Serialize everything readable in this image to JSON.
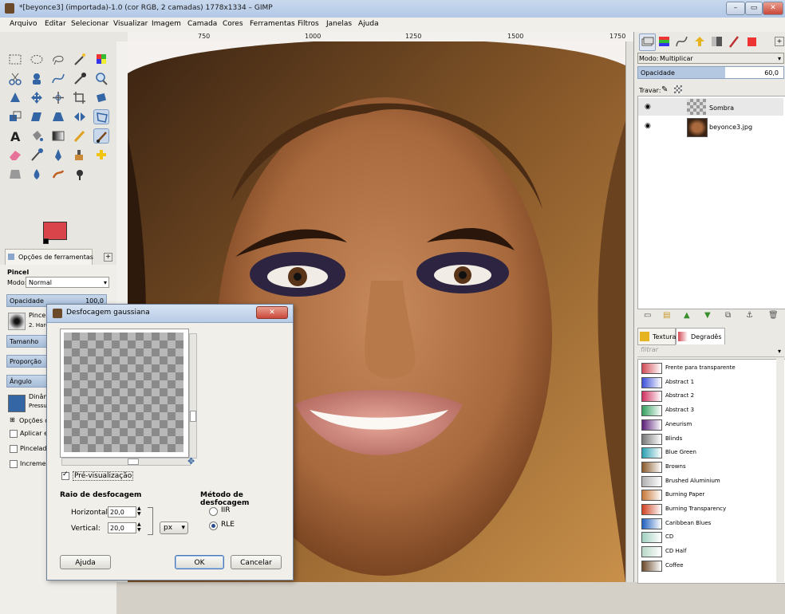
{
  "window": {
    "title": "*[beyonce3] (importada)-1.0 (cor RGB, 2 camadas) 1778x1334 – GIMP"
  },
  "menu": [
    "Arquivo",
    "Editar",
    "Selecionar",
    "Visualizar",
    "Imagem",
    "Camada",
    "Cores",
    "Ferramentas",
    "Filtros",
    "Janelas",
    "Ajuda"
  ],
  "ruler": {
    "ticks": [
      "750",
      "1000",
      "1250",
      "1500",
      "1750"
    ]
  },
  "tool_options": {
    "tab_label": "Opções de ferramentas",
    "section": "Pincel",
    "mode_label": "Modo:",
    "mode_value": "Normal",
    "opacity_label": "Opacidade",
    "opacity_value": "100,0",
    "brush_label": "Pincel",
    "brush_value": "2. Hardness 050",
    "size_label": "Tamanho",
    "ratio_label": "Proporção",
    "angle_label": "Ângulo",
    "dynamics_label": "Dinâm",
    "dynamics_value": "Pressu",
    "dynamics_options": "Opções do",
    "apply_jitter": "Aplicar es",
    "incremental_label": "Pincelada",
    "incremental2": "Increment"
  },
  "layers": {
    "mode_label": "Modo:",
    "mode_value": "Multiplicar",
    "opacity_label": "Opacidade",
    "opacity_value": "60,0",
    "lock_label": "Travar:",
    "items": [
      {
        "name": "Sombra"
      },
      {
        "name": "beyonce3.jpg"
      }
    ]
  },
  "gradients": {
    "tab_textures": "Texturas",
    "tab_gradients": "Degradês",
    "filter_placeholder": "filtrar",
    "items": [
      {
        "name": "Frente para transparente",
        "color": "#d24a55"
      },
      {
        "name": "Abstract 1",
        "color": "#3b4fd8"
      },
      {
        "name": "Abstract 2",
        "color": "#d0305f"
      },
      {
        "name": "Abstract 3",
        "color": "#33a060"
      },
      {
        "name": "Aneurism",
        "color": "#5a1f7a"
      },
      {
        "name": "Blinds",
        "color": "#777777"
      },
      {
        "name": "Blue Green",
        "color": "#2aa0b0"
      },
      {
        "name": "Browns",
        "color": "#8a5a2b"
      },
      {
        "name": "Brushed Aluminium",
        "color": "#b0b0b0"
      },
      {
        "name": "Burning Paper",
        "color": "#c87838"
      },
      {
        "name": "Burning Transparency",
        "color": "#d04020"
      },
      {
        "name": "Caribbean Blues",
        "color": "#2060c0"
      },
      {
        "name": "CD",
        "color": "#a0d0c0"
      },
      {
        "name": "CD Half",
        "color": "#b8d8c8"
      },
      {
        "name": "Coffee",
        "color": "#6b4a2a"
      }
    ]
  },
  "dialog": {
    "title": "Desfocagem gaussiana",
    "preview_label": "Pré-visualização",
    "radius_label": "Raio de desfocagem",
    "horizontal_label": "Horizontal:",
    "horizontal_value": "20,0",
    "vertical_label": "Vertical:",
    "vertical_value": "20,0",
    "unit_value": "px",
    "method_label": "Método de desfocagem",
    "method_iir": "IIR",
    "method_rle": "RLE",
    "help_label": "Ajuda",
    "ok_label": "OK",
    "cancel_label": "Cancelar"
  },
  "colors": {
    "fg": "#d9444a",
    "bg": "#ffffff",
    "accent": "#b7cbe6"
  }
}
